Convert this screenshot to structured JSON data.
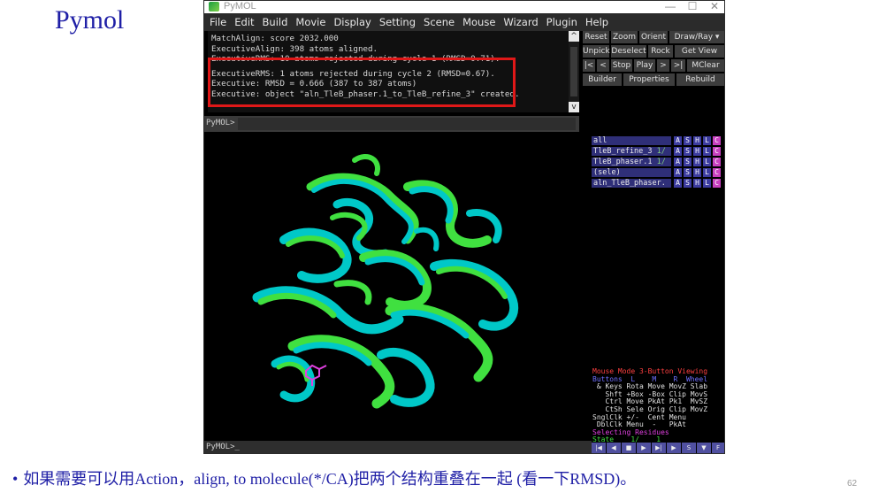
{
  "slide": {
    "title": "Pymol",
    "bullet": "如果需要可以用Action，align, to molecule(*/CA)把两个结构重叠在一起 (看一下RMSD)。",
    "bullet_marker": "•",
    "page_number": "62",
    "title_color": "#1f1fa6"
  },
  "window": {
    "title": "PyMOL",
    "controls": {
      "minimize": "—",
      "maximize": "☐",
      "close": "✕"
    },
    "menu": [
      "File",
      "Edit",
      "Build",
      "Movie",
      "Display",
      "Setting",
      "Scene",
      "Mouse",
      "Wizard",
      "Plugin",
      "Help"
    ]
  },
  "console": {
    "lines": [
      "MatchAlign: score 2032.000",
      "ExecutiveAlign: 398 atoms aligned.",
      "ExecutiveRMS: 10 atoms rejected during cycle 1 (RMSD=0.71).",
      "ExecutiveRMS: 1 atoms rejected during cycle 2 (RMSD=0.67).",
      "Executive: RMSD =    0.666 (387 to 387 atoms)",
      "Executive: object \"aln_TleB_phaser.1_to_TleB_refine_3\" created."
    ],
    "scroll_up": "^",
    "scroll_down": "v",
    "highlight_color": "#e01818"
  },
  "buttons": {
    "row1": [
      "Reset",
      "Zoom",
      "Orient",
      "Draw/Ray ▾"
    ],
    "row2": [
      "Unpick",
      "Deselect",
      "Rock",
      "Get View"
    ],
    "row3": [
      "|<",
      "<",
      "Stop",
      "Play",
      ">",
      ">|",
      "MClear"
    ],
    "row4": [
      "Builder",
      "Properties",
      "Rebuild"
    ]
  },
  "command_prompt": "PyMOL>",
  "status_prompt": "PyMOL>_",
  "objects": [
    {
      "name": "all",
      "frac": ""
    },
    {
      "name": "TleB_refine_3",
      "frac": "1/"
    },
    {
      "name": "TleB_phaser.1",
      "frac": "1/"
    },
    {
      "name": "(sele)",
      "frac": ""
    },
    {
      "name": "aln_TleB_phaser.",
      "frac": ""
    }
  ],
  "object_buttons": [
    "A",
    "S",
    "H",
    "L",
    "C"
  ],
  "mouse_panel": {
    "l1": "Mouse Mode 3-Button Viewing",
    "l2": "Buttons  L    M    R  Wheel",
    "l3": " & Keys Rota Move MovZ Slab",
    "l4": "   Shft +Box -Box Clip MovS",
    "l5": "   Ctrl Move PkAt Pk1  MvSZ",
    "l6": "   CtSh Sele Orig Clip MovZ",
    "l7": "SnglClk +/-  Cent Menu",
    "l8": " DblClk Menu  -   PkAt",
    "l9": "Selecting Residues",
    "l10": "State    1/    1"
  },
  "movie_controls": [
    "|◀",
    "◀",
    "■",
    "▶",
    "▶|",
    "▶",
    "S",
    "▼",
    "F"
  ],
  "colors": {
    "structure_a": "#00c8c8",
    "structure_b": "#40e040",
    "ligand": "#e040e0",
    "menubar": "#2b2b2b"
  }
}
